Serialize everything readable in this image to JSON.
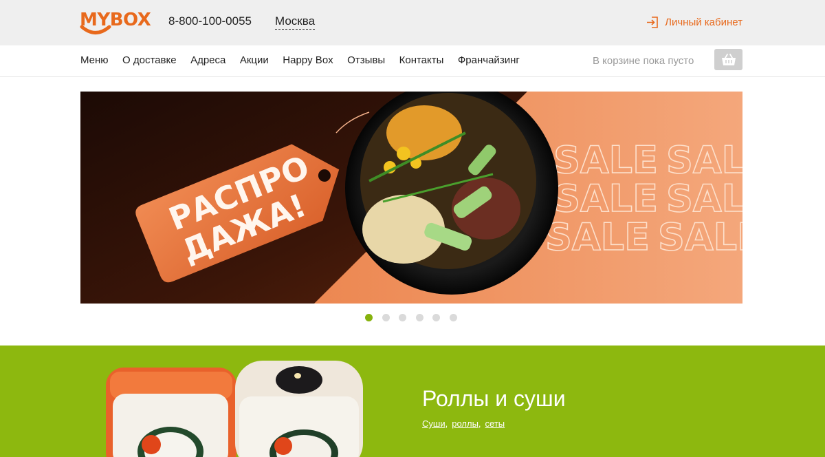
{
  "colors": {
    "brand": "#e8691c",
    "accent_green": "#8db80f",
    "dot_active": "#86b20d"
  },
  "header": {
    "logo_text": "MYBOX",
    "phone": "8-800-100-0055",
    "city": "Москва",
    "account_label": "Личный кабинет",
    "account_icon": "login-icon"
  },
  "nav": {
    "items": [
      {
        "label": "Меню"
      },
      {
        "label": "О доставке"
      },
      {
        "label": "Адреса"
      },
      {
        "label": "Акции"
      },
      {
        "label": "Happy Box"
      },
      {
        "label": "Отзывы"
      },
      {
        "label": "Контакты"
      },
      {
        "label": "Франчайзинг"
      }
    ],
    "cart_status": "В корзине пока пусто",
    "cart_icon": "basket-icon"
  },
  "banner": {
    "tag_line1": "РАСПРО",
    "tag_line2": "ДАЖА!",
    "sale_text": "SALE",
    "slide_count": 6,
    "active_slide": 1
  },
  "category": {
    "title": "Роллы и суши",
    "links": [
      "Суши",
      "роллы",
      "сеты"
    ]
  }
}
